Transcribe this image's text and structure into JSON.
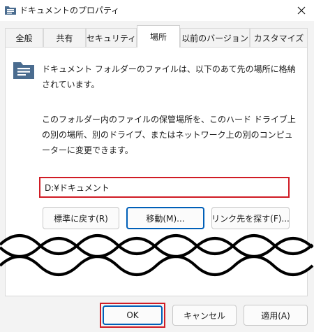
{
  "window": {
    "title": "ドキュメントのプロパティ"
  },
  "tabs": [
    {
      "label": "全般"
    },
    {
      "label": "共有"
    },
    {
      "label": "セキュリティ"
    },
    {
      "label": "場所",
      "active": true
    },
    {
      "label": "以前のバージョン"
    },
    {
      "label": "カスタマイズ"
    }
  ],
  "location": {
    "description1": "ドキュメント フォルダーのファイルは、以下のあて先の場所に格納されています。",
    "description2": "このフォルダー内のファイルの保管場所を、このハード ドライブ上の別の場所、別のドライブ、またはネットワーク上の別のコンピューターに変更できます。",
    "path_value": "D:¥ドキュメント",
    "restore_default_label": "標準に戻す(R)",
    "move_label": "移動(M)...",
    "find_target_label": "リンク先を探す(F)..."
  },
  "footer": {
    "ok_label": "OK",
    "cancel_label": "キャンセル",
    "apply_label": "適用(A)"
  },
  "colors": {
    "highlight_red": "#d01c25",
    "focus_blue": "#005fb8",
    "folder_icon": "#4a6c8f"
  },
  "icons": {
    "title": "documents-folder-icon",
    "close": "close-icon",
    "content": "documents-folder-icon"
  }
}
